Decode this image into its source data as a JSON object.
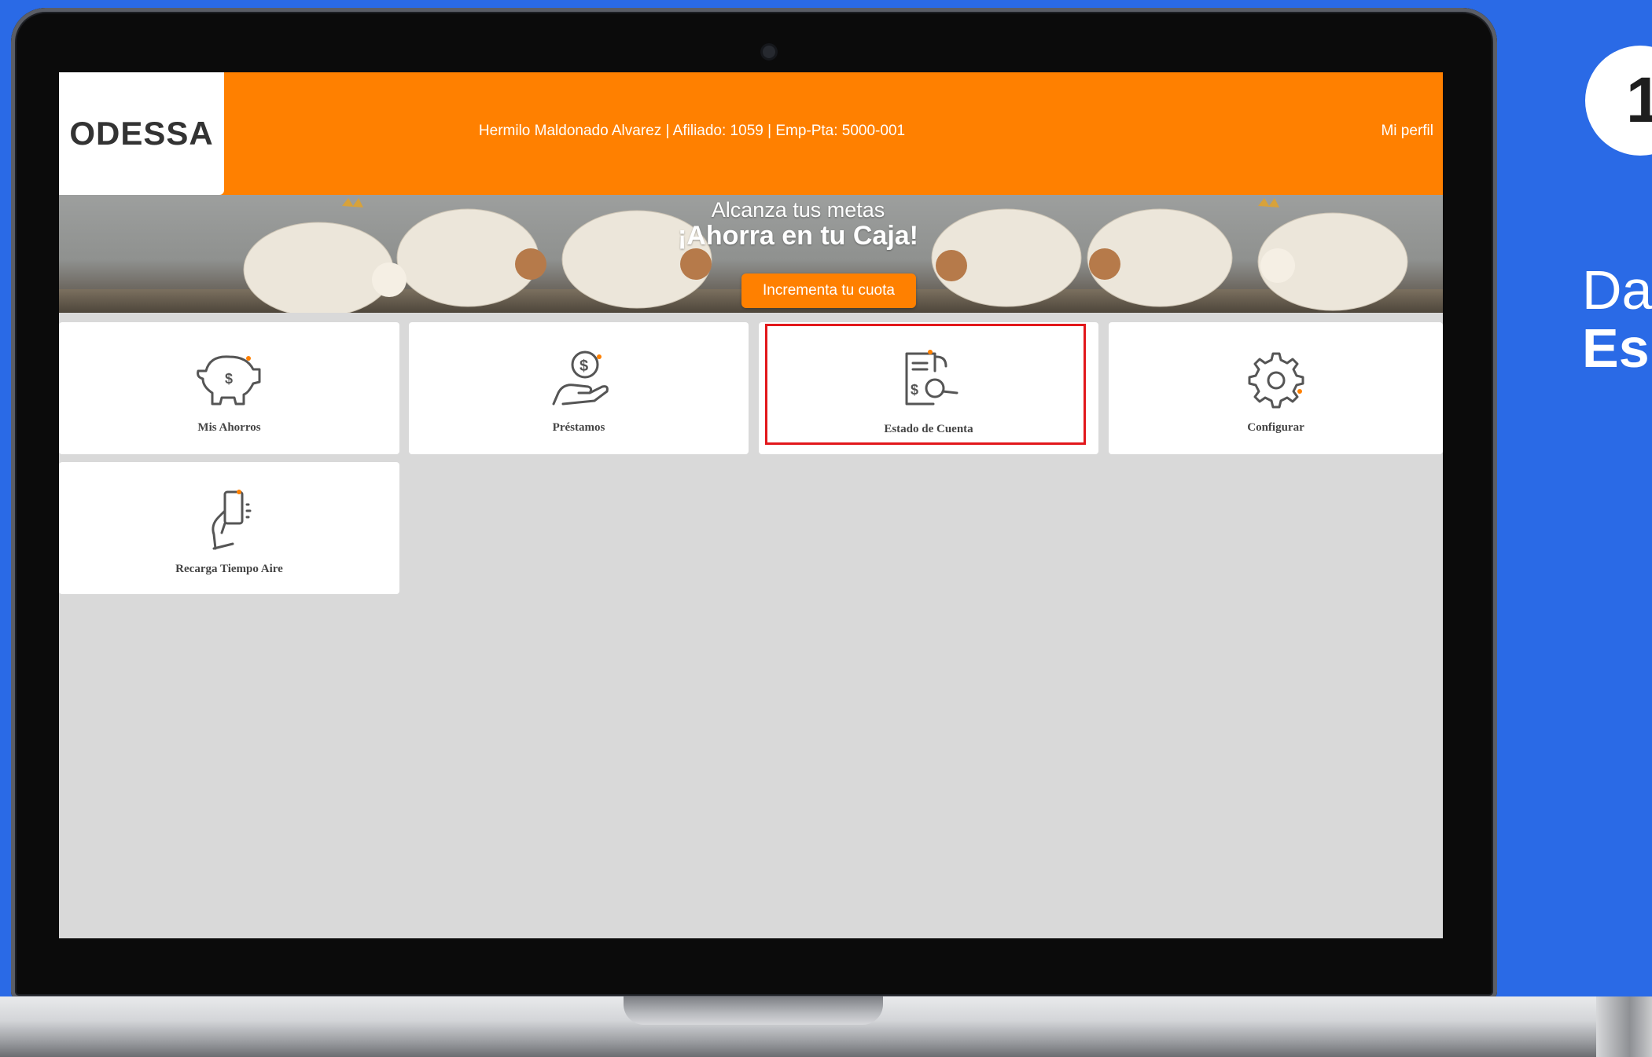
{
  "header": {
    "logo": "ODESSA",
    "user_info": "Hermilo Maldonado Alvarez | Afiliado: 1059 | Emp-Pta: 5000-001",
    "profile_link": "Mi perfil"
  },
  "banner": {
    "subtitle": "Alcanza tus metas",
    "title": "¡Ahorra en tu Caja!",
    "button": "Incrementa tu cuota"
  },
  "tiles": [
    {
      "label": "Mis Ahorros",
      "icon": "piggy-bank-icon"
    },
    {
      "label": "Préstamos",
      "icon": "hand-coin-icon"
    },
    {
      "label": "Estado de Cuenta",
      "icon": "document-search-icon"
    },
    {
      "label": "Configurar",
      "icon": "gear-icon"
    },
    {
      "label": "Recarga Tiempo Aire",
      "icon": "phone-hand-icon"
    }
  ],
  "side": {
    "step": "1",
    "title": "Da",
    "subtitle": "Es"
  },
  "colors": {
    "brand_orange": "#ff8000",
    "background_blue": "#2a6ae6",
    "highlight_red": "#e2171b"
  }
}
